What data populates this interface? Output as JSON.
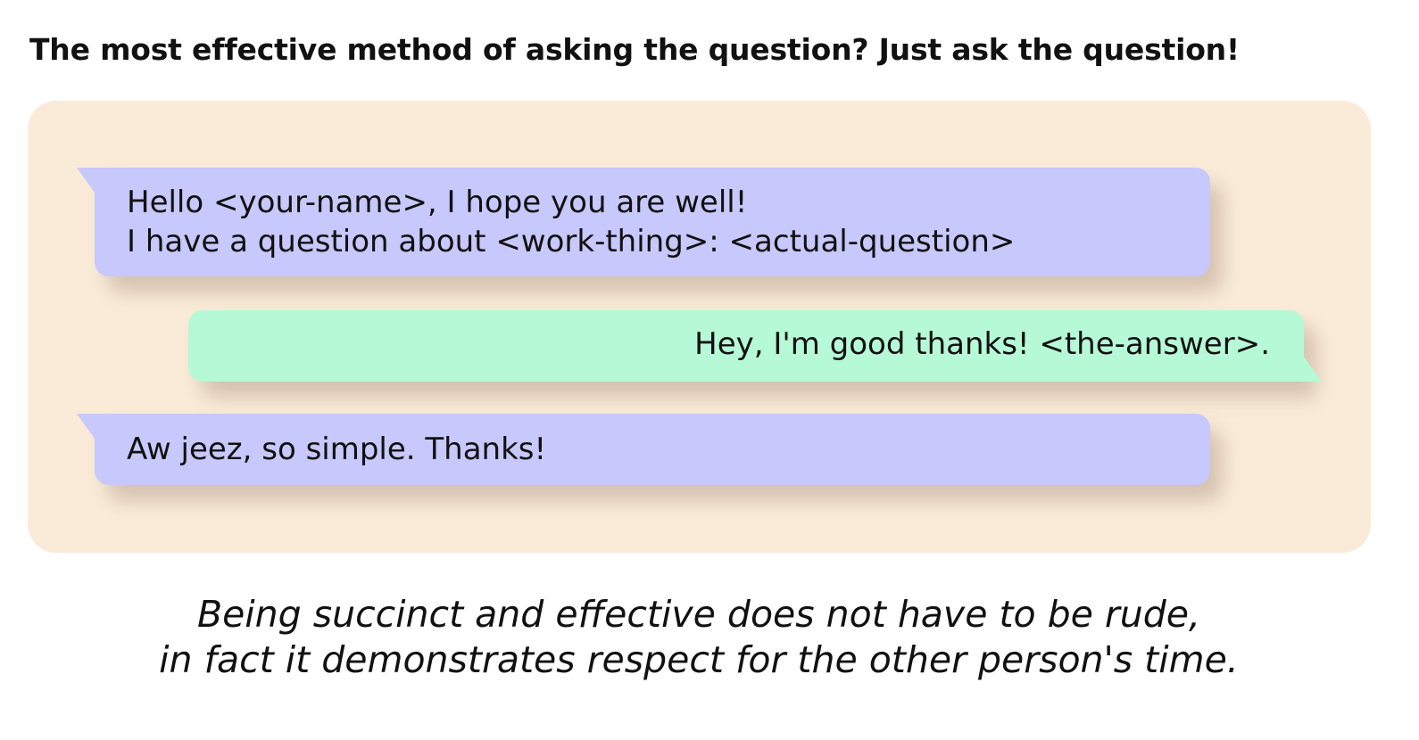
{
  "heading": "The most effective method of asking the question? Just ask the question!",
  "messages": [
    {
      "direction": "incoming",
      "lines": [
        "Hello <your-name>, I hope you are well!",
        "I have a question about <work-thing>: <actual-question>"
      ]
    },
    {
      "direction": "outgoing",
      "lines": [
        "Hey, I'm good thanks! <the-answer>."
      ]
    },
    {
      "direction": "incoming",
      "lines": [
        "Aw jeez, so simple. Thanks!"
      ]
    }
  ],
  "caption": {
    "lines": [
      "Being succinct and effective does not have to be rude,",
      "in fact it demonstrates respect for the other person's time."
    ]
  },
  "colors": {
    "panel_background": "#faebd9",
    "incoming_bubble": "#c7c8fb",
    "outgoing_bubble": "#b6f9d6",
    "text": "#111111"
  }
}
